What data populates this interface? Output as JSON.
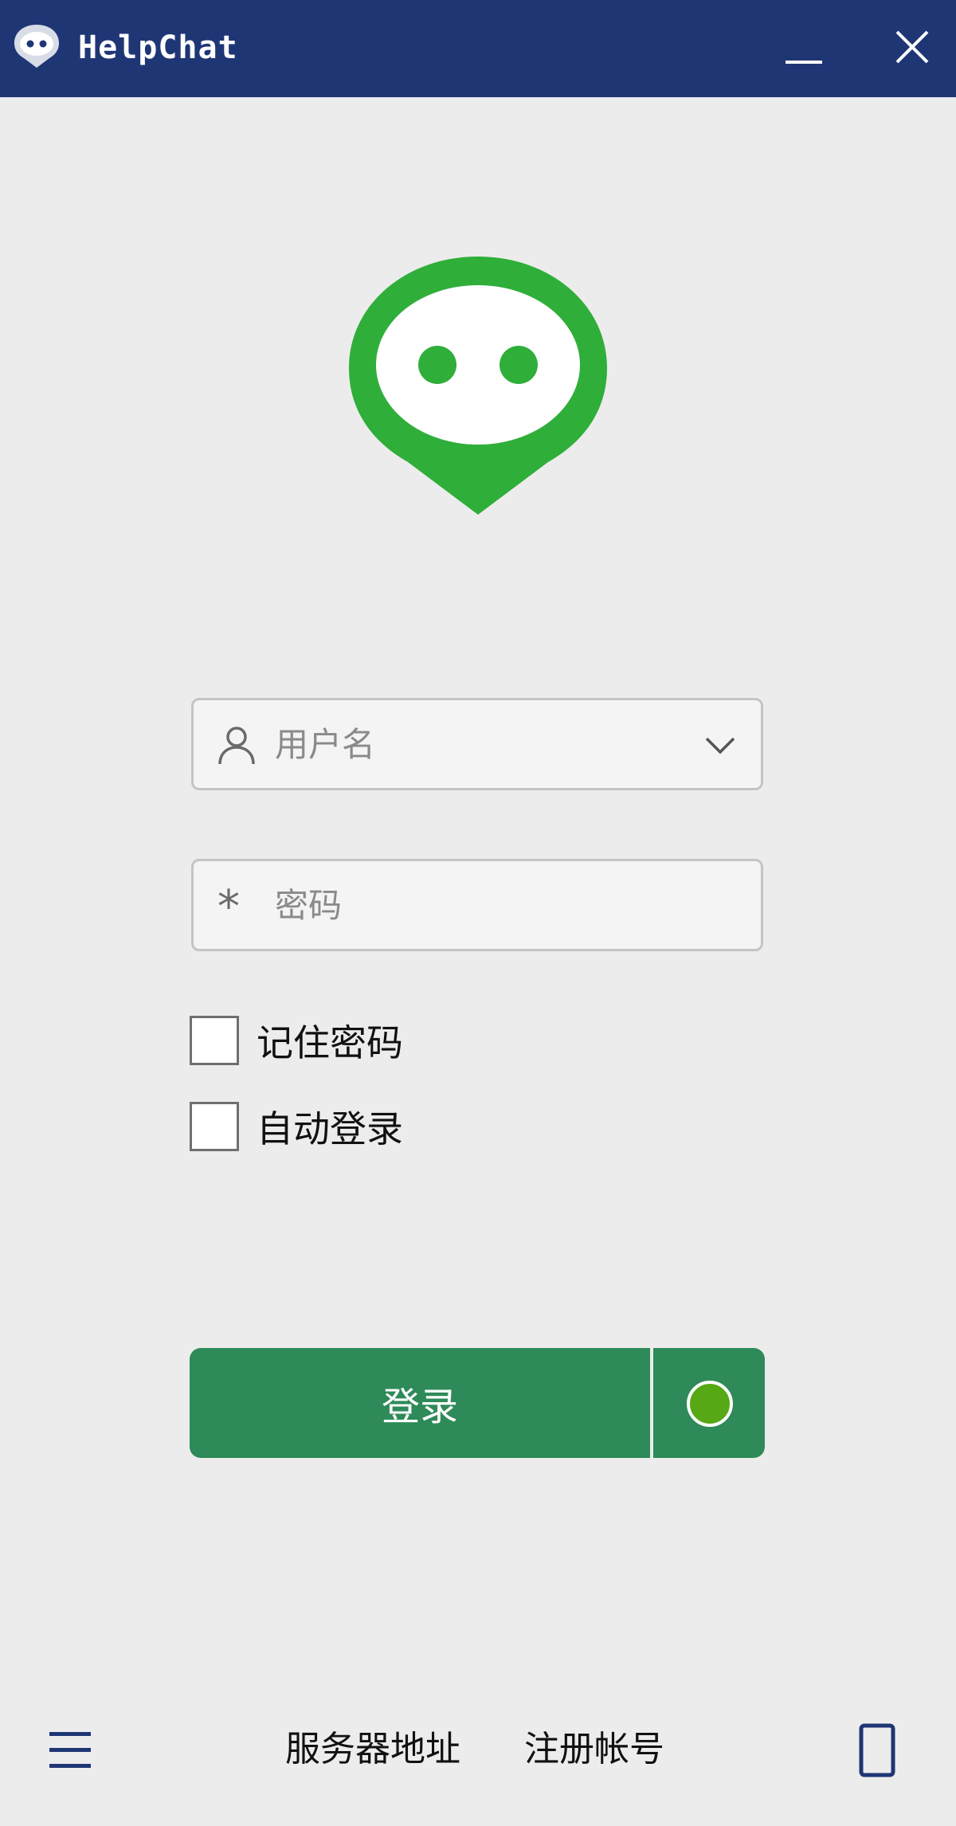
{
  "window": {
    "title": "HelpChat",
    "minimize_icon": "minimize-icon",
    "close_icon": "close-icon",
    "title_bar_color": "#1f3675"
  },
  "logo": {
    "icon": "helpchat-logo",
    "color": "#2fae3a"
  },
  "login_form": {
    "username_placeholder": "用户名",
    "username_value": "",
    "password_placeholder": "密码",
    "password_value": "",
    "username_icon": "user-icon",
    "password_icon": "asterisk-icon",
    "dropdown_icon": "chevron-down-icon",
    "remember_password_label": "记住密码",
    "remember_password_checked": false,
    "auto_login_label": "自动登录",
    "auto_login_checked": false,
    "login_button_label": "登录",
    "status_indicator_color": "#56a814",
    "button_color": "#2e8a58"
  },
  "footer": {
    "menu_icon": "hamburger-menu-icon",
    "server_address_label": "服务器地址",
    "register_account_label": "注册帐号",
    "phone_icon": "phone-icon"
  }
}
